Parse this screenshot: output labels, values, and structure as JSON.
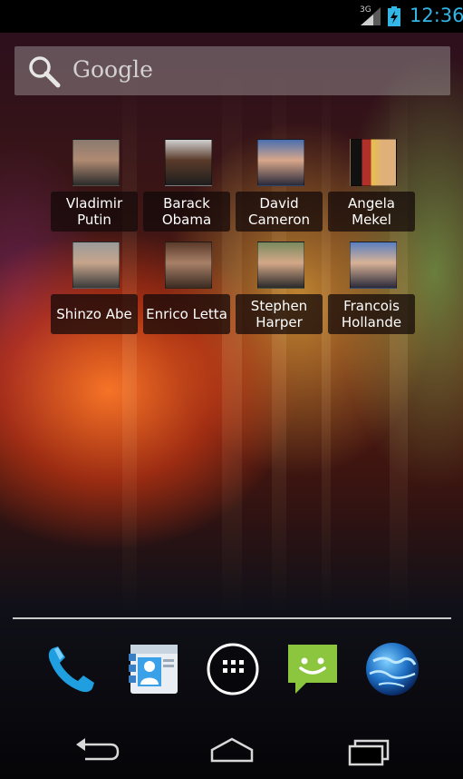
{
  "status_bar": {
    "network_type": "3G",
    "time": "12:36",
    "accent_color": "#33b5e5"
  },
  "search": {
    "label": "Google",
    "icon": "search-icon"
  },
  "contacts": [
    {
      "first": "Vladimir",
      "last": "Putin",
      "photo_colors": [
        "#b08a72",
        "#2b2b2b"
      ]
    },
    {
      "first": "Barack",
      "last": "Obama",
      "photo_colors": [
        "#5a3a2a",
        "#cfcfcf"
      ]
    },
    {
      "first": "David",
      "last": "Cameron",
      "photo_colors": [
        "#d8a78a",
        "#4a6fb0"
      ]
    },
    {
      "first": "Angela Mekel",
      "last": "",
      "photo_colors": [
        "#e0b07a",
        "#b0302a"
      ]
    },
    {
      "first": "Shinzo Abe",
      "last": "",
      "photo_colors": [
        "#c7a58c",
        "#3a3a3a"
      ]
    },
    {
      "first": "Enrico Letta",
      "last": "",
      "photo_colors": [
        "#a88068",
        "#3b2b22"
      ]
    },
    {
      "first": "Stephen",
      "last": "Harper",
      "photo_colors": [
        "#d4a888",
        "#7a6a4e"
      ]
    },
    {
      "first": "Francois",
      "last": "Hollande",
      "photo_colors": [
        "#d8b296",
        "#5a7fc0"
      ]
    }
  ],
  "dock": [
    {
      "name": "phone-icon"
    },
    {
      "name": "contacts-app-icon"
    },
    {
      "name": "app-drawer-icon"
    },
    {
      "name": "messaging-icon"
    },
    {
      "name": "browser-globe-icon"
    }
  ],
  "navigation": [
    {
      "name": "back-button"
    },
    {
      "name": "home-button"
    },
    {
      "name": "recent-apps-button"
    }
  ]
}
